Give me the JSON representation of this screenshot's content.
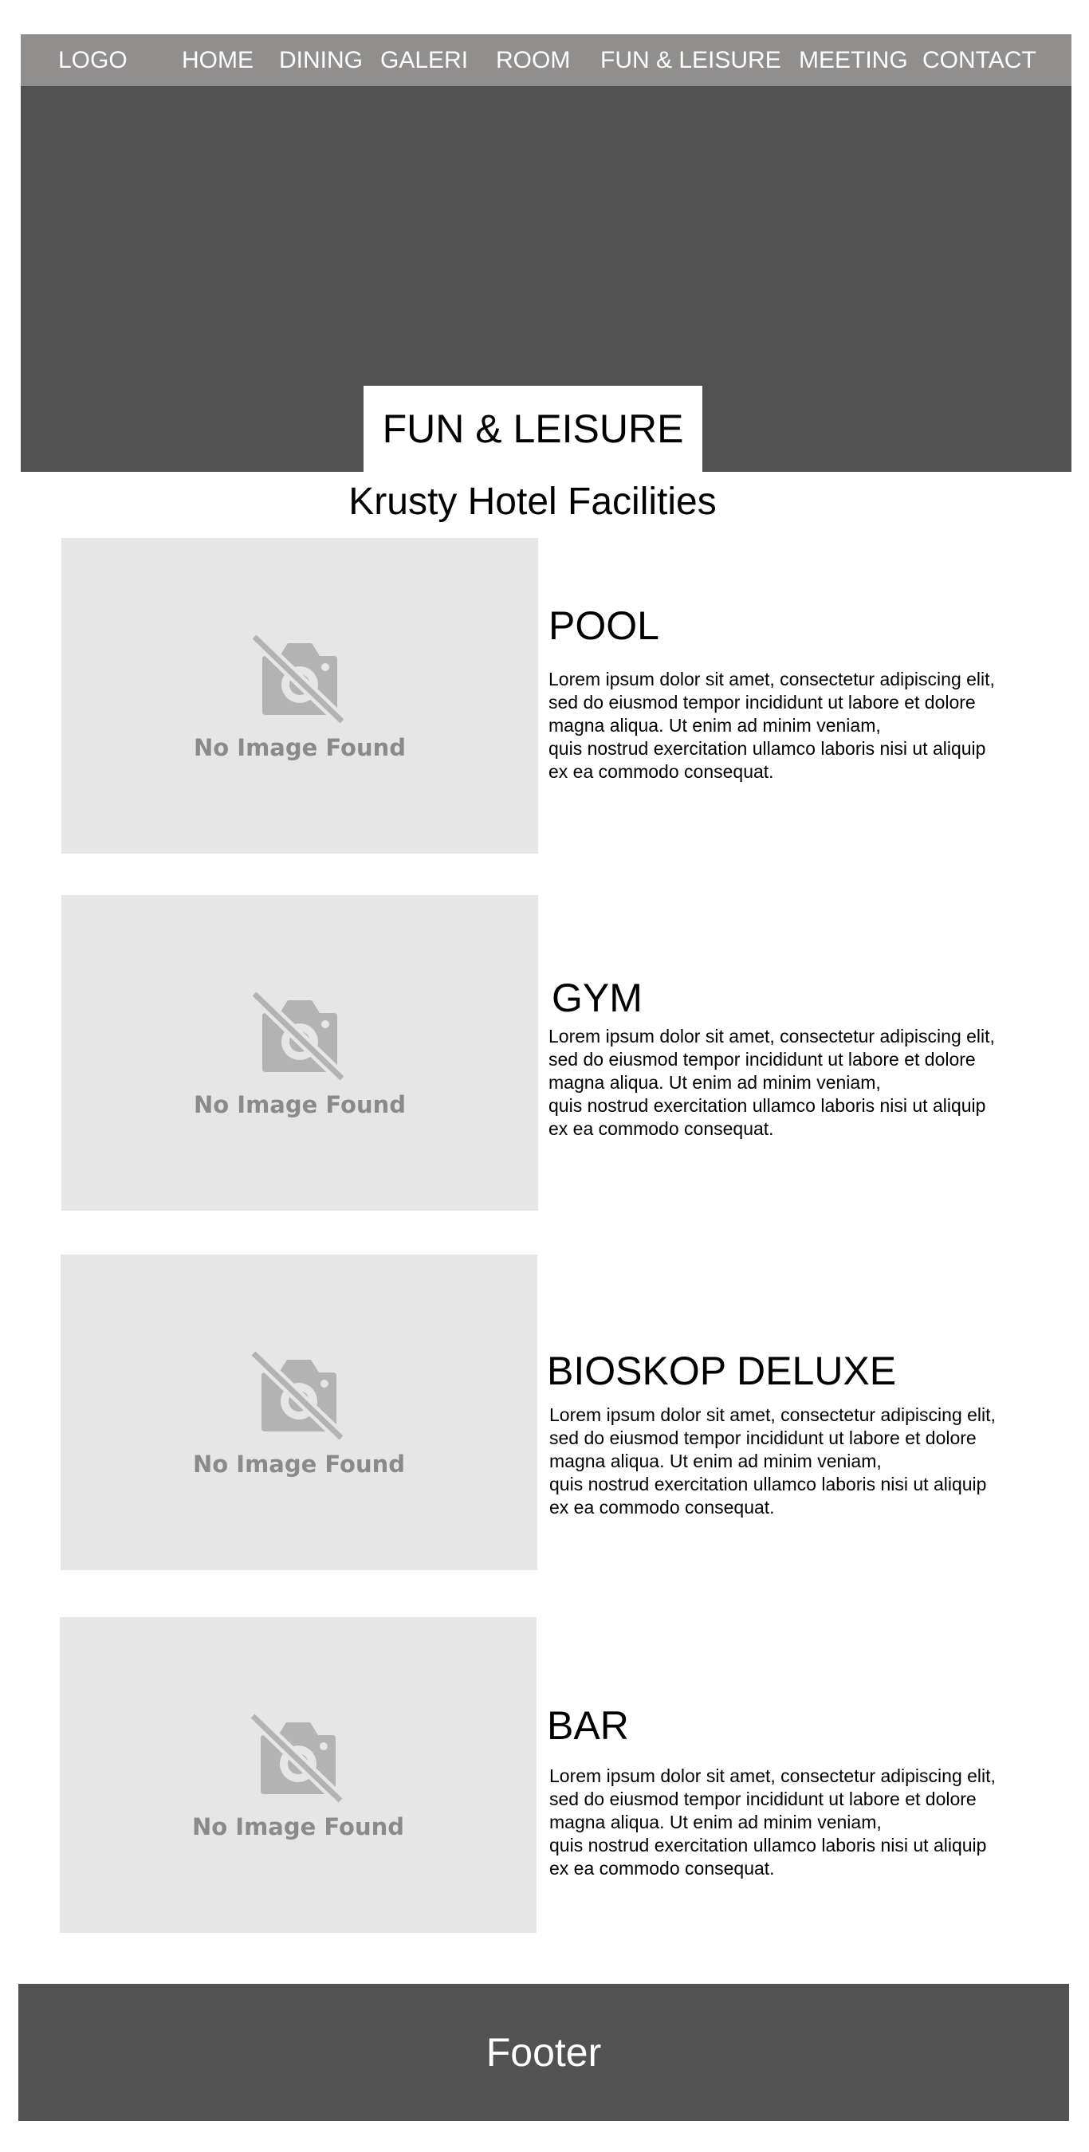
{
  "nav": {
    "logo": "LOGO",
    "items": [
      "HOME",
      "DINING",
      "GALERI",
      "ROOM",
      "FUN & LEISURE",
      "MEETING",
      "CONTACT"
    ]
  },
  "hero": {
    "title": "FUN & LEISURE"
  },
  "section": {
    "title": "Krusty Hotel Facilities"
  },
  "facilities": [
    {
      "title": "POOL",
      "image_placeholder": "No Image Found",
      "description": "Lorem ipsum dolor sit amet, consectetur adipiscing elit,\nsed do eiusmod tempor incididunt ut labore et dolore\nmagna aliqua. Ut enim ad minim veniam,\nquis nostrud exercitation ullamco laboris nisi ut aliquip\nex ea commodo consequat."
    },
    {
      "title": "GYM",
      "image_placeholder": "No Image Found",
      "description": "Lorem ipsum dolor sit amet, consectetur adipiscing elit,\nsed do eiusmod tempor incididunt ut labore et dolore\nmagna aliqua. Ut enim ad minim veniam,\nquis nostrud exercitation ullamco laboris nisi ut aliquip\nex ea commodo consequat."
    },
    {
      "title": "BIOSKOP DELUXE",
      "image_placeholder": "No Image Found",
      "description": "Lorem ipsum dolor sit amet, consectetur adipiscing elit,\nsed do eiusmod tempor incididunt ut labore et dolore\nmagna aliqua. Ut enim ad minim veniam,\nquis nostrud exercitation ullamco laboris nisi ut aliquip\nex ea commodo consequat."
    },
    {
      "title": "BAR",
      "image_placeholder": "No Image Found",
      "description": "Lorem ipsum dolor sit amet, consectetur adipiscing elit,\nsed do eiusmod tempor incididunt ut labore et dolore\nmagna aliqua. Ut enim ad minim veniam,\nquis nostrud exercitation ullamco laboris nisi ut aliquip\nex ea commodo consequat."
    }
  ],
  "footer": {
    "text": "Footer"
  },
  "colors": {
    "nav_bg": "#918e8e",
    "hero_bg": "#525252",
    "placeholder_bg": "#e6e6e6",
    "placeholder_icon": "#b3b3b3",
    "footer_bg": "#525252"
  }
}
